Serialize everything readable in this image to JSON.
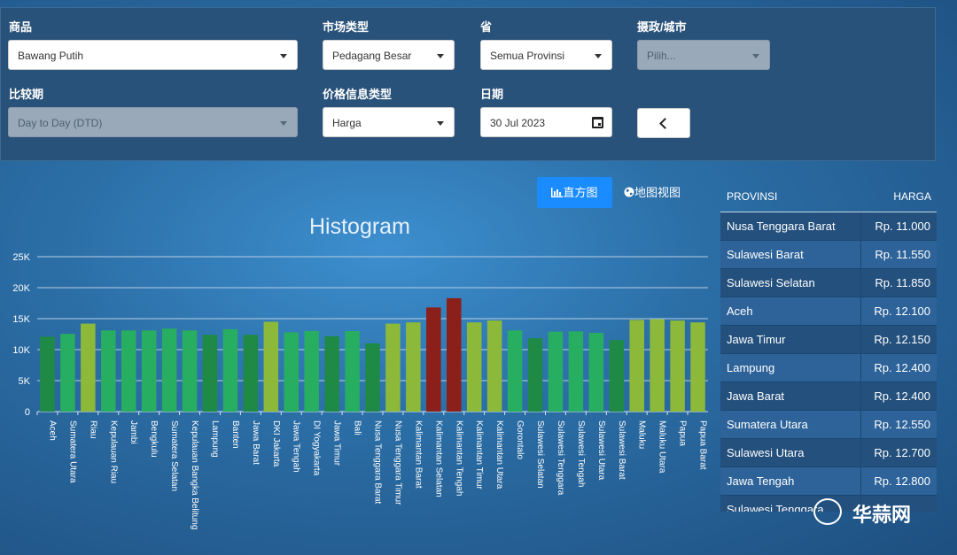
{
  "filters": {
    "commodity_label": "商品",
    "commodity_value": "Bawang Putih",
    "market_label": "市场类型",
    "market_value": "Pedagang Besar",
    "province_label": "省",
    "province_value": "Semua Provinsi",
    "city_label": "摄政/城市",
    "city_placeholder": "Pilih...",
    "compare_label": "比较期",
    "compare_value": "Day to Day (DTD)",
    "price_type_label": "价格信息类型",
    "price_type_value": "Harga",
    "date_label": "日期",
    "date_value": "30 Jul 2023"
  },
  "tabs": {
    "histogram": "直方图",
    "map": "地图视图"
  },
  "chart_data": {
    "type": "bar",
    "title": "Histogram",
    "ylim": [
      0,
      25000
    ],
    "ytick_labels": [
      "0",
      "5K",
      "10K",
      "15K",
      "20K",
      "25K"
    ],
    "grid": true,
    "categories": [
      "Aceh",
      "Sumatera Utara",
      "Riau",
      "Kepulauan Riau",
      "Jambi",
      "Bengkulu",
      "Sumatera Selatan",
      "Kepulauan Bangka Belitung",
      "Lampung",
      "Banten",
      "Jawa Barat",
      "DKI Jakarta",
      "Jawa Tengah",
      "DI Yogyakarta",
      "Jawa Timur",
      "Bali",
      "Nusa Tenggara Barat",
      "Nusa Tenggara Timur",
      "Kalimantan Barat",
      "Kalimantan Selatan",
      "Kalimantan Tengah",
      "Kalimantan Timur",
      "Kalimantan Utara",
      "Gorontalo",
      "Sulawesi Selatan",
      "Sulawesi Tenggara",
      "Sulawesi Tengah",
      "Sulawesi Utara",
      "Sulawesi Barat",
      "Maluku",
      "Maluku Utara",
      "Papua",
      "Papua Barat"
    ],
    "values": [
      12100,
      12550,
      14200,
      13100,
      13100,
      13100,
      13400,
      13100,
      12400,
      13300,
      12400,
      14500,
      12800,
      13000,
      12150,
      13000,
      11000,
      14200,
      14400,
      16800,
      18300,
      14400,
      14700,
      13100,
      11850,
      12900,
      12950,
      12700,
      11550,
      14800,
      14900,
      14700,
      14400
    ],
    "colors": [
      "#1e8a46",
      "#27ae60",
      "#8db93a",
      "#27ae60",
      "#27ae60",
      "#27ae60",
      "#27ae60",
      "#27ae60",
      "#1e8a46",
      "#27ae60",
      "#1e8a46",
      "#8db93a",
      "#27ae60",
      "#27ae60",
      "#1e8a46",
      "#27ae60",
      "#1e8a46",
      "#8db93a",
      "#8db93a",
      "#8b1f1a",
      "#8b1f1a",
      "#8db93a",
      "#8db93a",
      "#27ae60",
      "#1e8a46",
      "#27ae60",
      "#27ae60",
      "#27ae60",
      "#1e8a46",
      "#8db93a",
      "#8db93a",
      "#8db93a",
      "#8db93a"
    ]
  },
  "table": {
    "header_province": "PROVINSI",
    "header_price": "HARGA",
    "rows": [
      {
        "province": "Nusa Tenggara Barat",
        "price": "Rp. 11.000"
      },
      {
        "province": "Sulawesi Barat",
        "price": "Rp. 11.550"
      },
      {
        "province": "Sulawesi Selatan",
        "price": "Rp. 11.850"
      },
      {
        "province": "Aceh",
        "price": "Rp. 12.100"
      },
      {
        "province": "Jawa Timur",
        "price": "Rp. 12.150"
      },
      {
        "province": "Lampung",
        "price": "Rp. 12.400"
      },
      {
        "province": "Jawa Barat",
        "price": "Rp. 12.400"
      },
      {
        "province": "Sumatera Utara",
        "price": "Rp. 12.550"
      },
      {
        "province": "Sulawesi Utara",
        "price": "Rp. 12.700"
      },
      {
        "province": "Jawa Tengah",
        "price": "Rp. 12.800"
      },
      {
        "province": "Sulawesi Tenggara",
        "price": ""
      }
    ]
  },
  "watermark": {
    "text": "华蒜网"
  }
}
